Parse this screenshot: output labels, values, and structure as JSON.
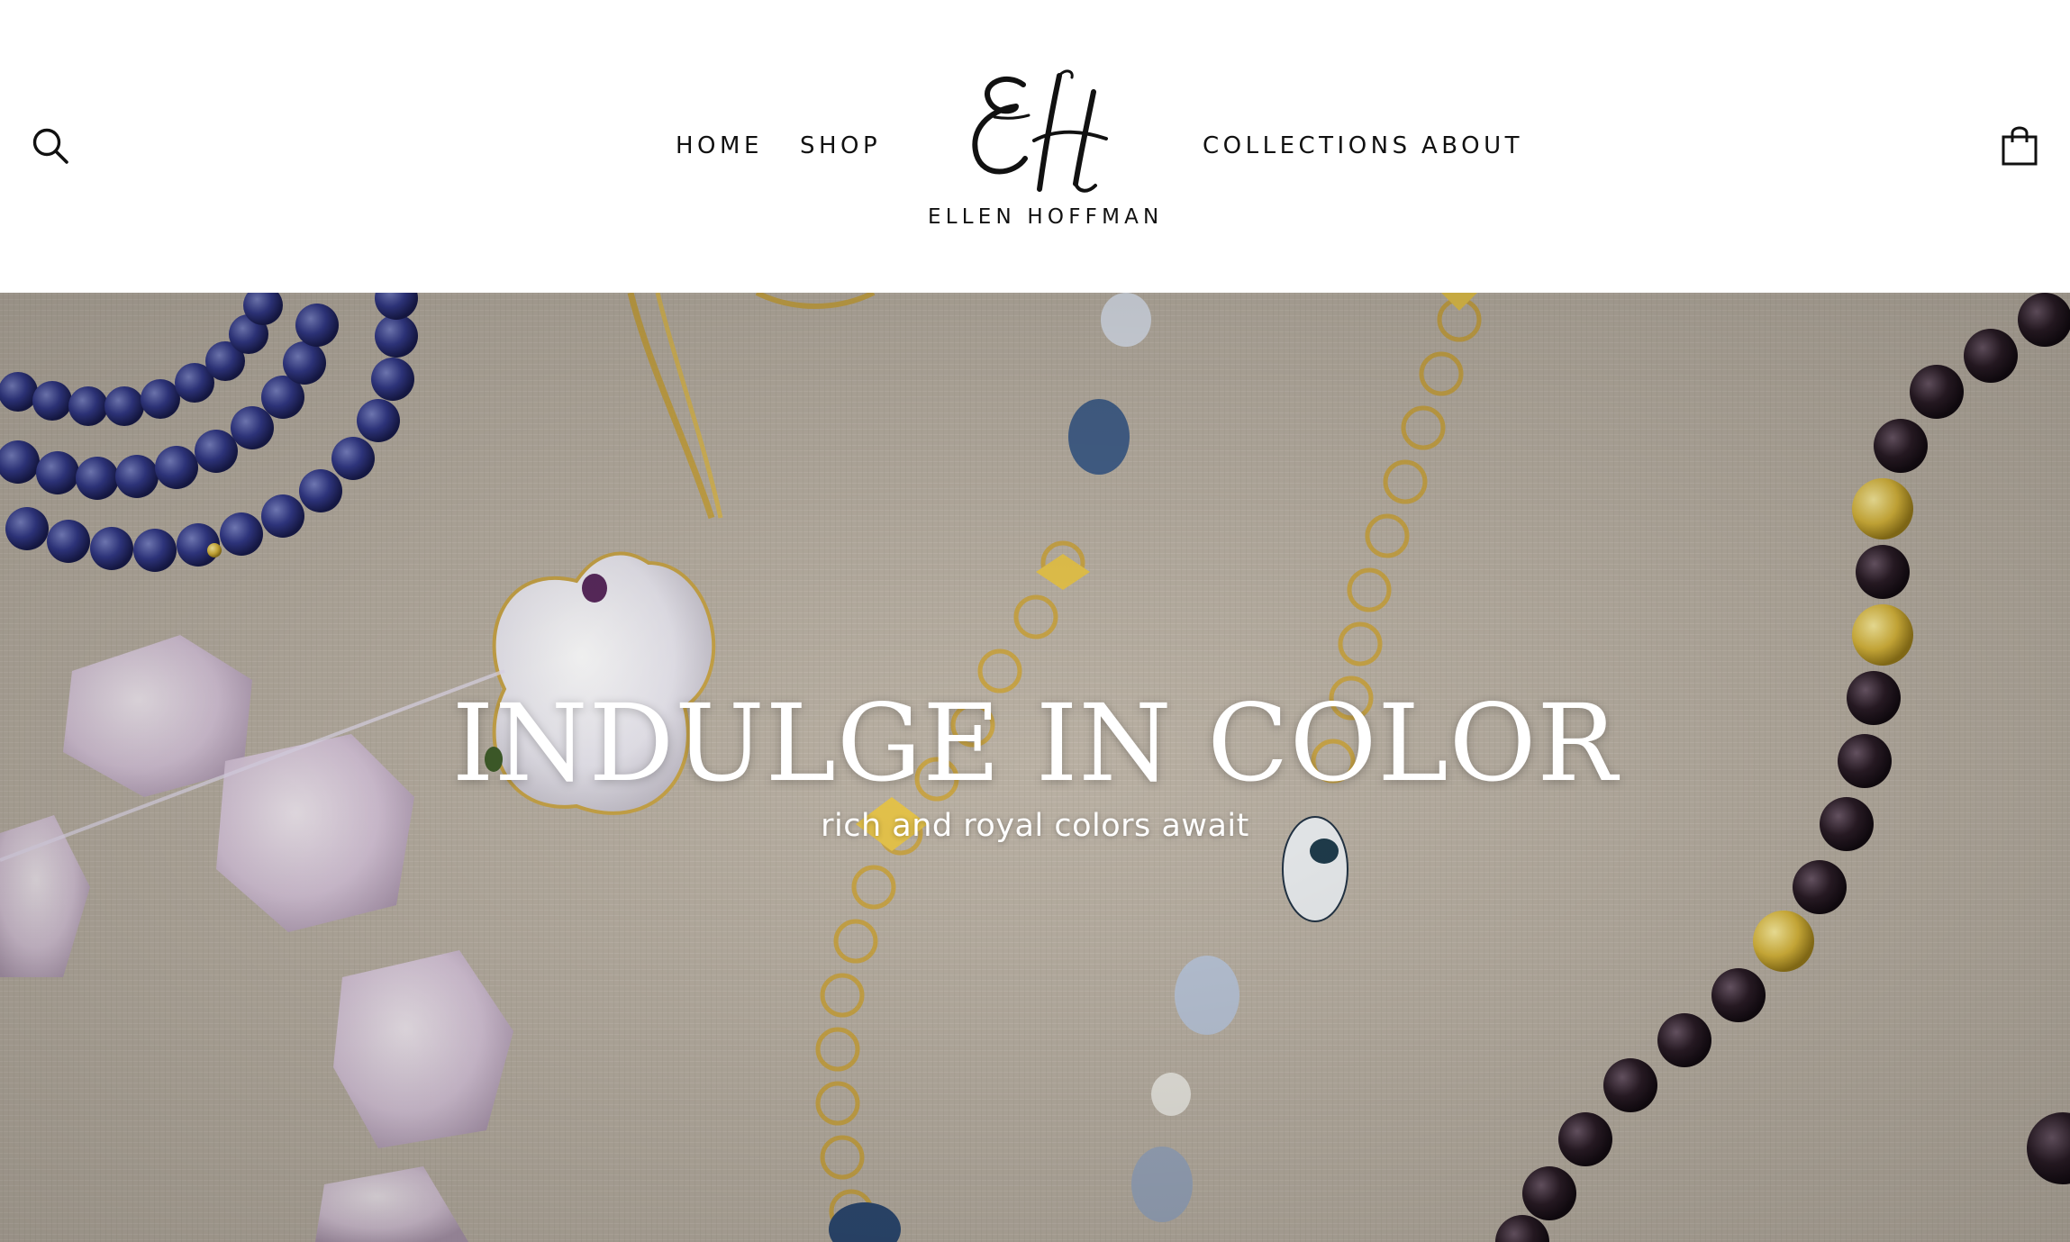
{
  "header": {
    "nav_left": [
      {
        "label": "HOME"
      },
      {
        "label": "SHOP"
      }
    ],
    "nav_right": [
      {
        "label": "COLLECTIONS"
      },
      {
        "label": "ABOUT"
      }
    ],
    "logo": {
      "monogram": "EH",
      "name": "ELLEN HOFFMAN"
    },
    "icons": {
      "search": "search-icon",
      "cart": "shopping-bag-icon"
    }
  },
  "hero": {
    "title": "INDULGE IN COLOR",
    "subtitle": "rich and royal colors await"
  },
  "colors": {
    "header_background": "#ffffff",
    "nav_text": "#111111",
    "hero_text": "#ffffff",
    "linen_background": "#b8afa2"
  }
}
